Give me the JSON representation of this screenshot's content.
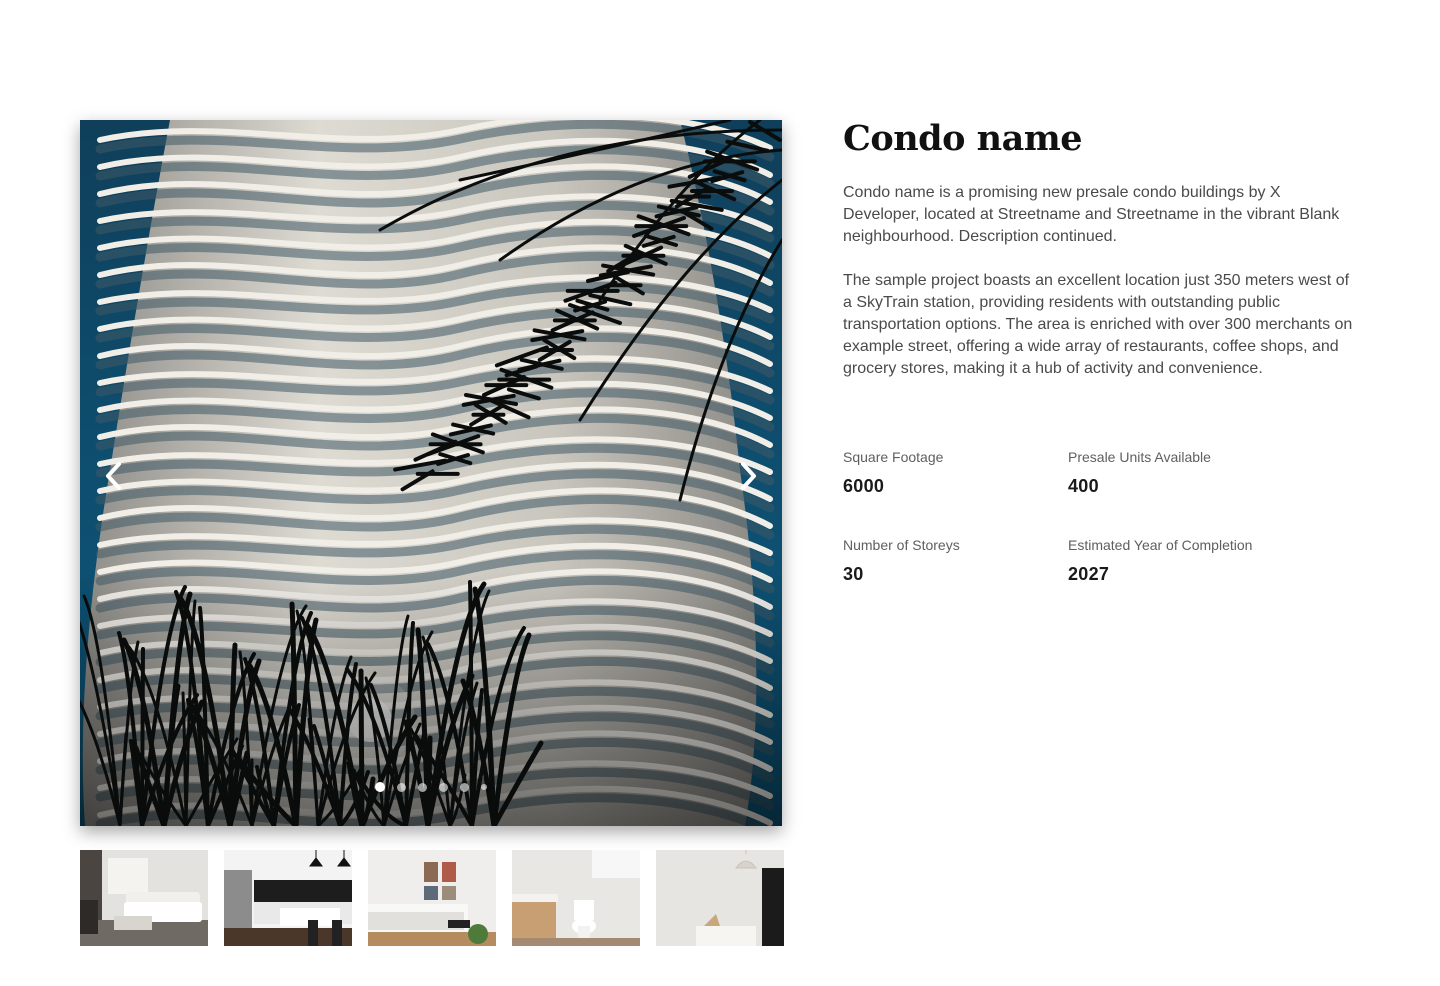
{
  "gallery": {
    "main_image_alt": "Curved white condo tower with palm fronds",
    "thumbnails": [
      {
        "name": "living-room"
      },
      {
        "name": "kitchen"
      },
      {
        "name": "bedroom"
      },
      {
        "name": "bathroom"
      },
      {
        "name": "interior"
      }
    ],
    "slide_count": 6,
    "active_slide": 1,
    "prev_icon": "chevron-left-icon",
    "next_icon": "chevron-right-icon"
  },
  "listing": {
    "title": "Condo name",
    "description_1": "Condo name is a promising new presale condo buildings by X Developer, located at Streetname and Streetname in the vibrant Blank neighbourhood. Description continued.",
    "description_2": "The sample project boasts an excellent location just 350 meters west of a SkyTrain station, providing residents with outstanding public transportation options. The area is enriched with over 300 merchants on example street, offering a wide array of restaurants, coffee shops, and grocery stores, making it a hub of activity and convenience.",
    "stats": {
      "square_footage_label": "Square Footage",
      "square_footage_value": "6000",
      "presale_units_label": "Presale Units Available",
      "presale_units_value": "400",
      "storeys_label": "Number of Storeys",
      "storeys_value": "30",
      "completion_label": "Estimated Year of Completion",
      "completion_value": "2027"
    }
  },
  "colors": {
    "sky": "#0e4d6e",
    "tower": "#d9d6cf",
    "text_primary": "#111111",
    "text_secondary": "#4a4a4a"
  }
}
